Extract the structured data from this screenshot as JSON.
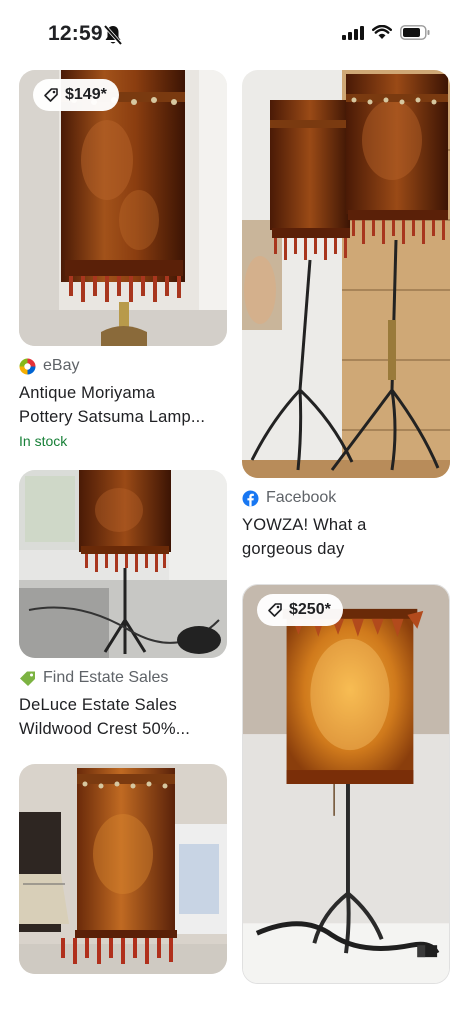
{
  "status_bar": {
    "time": "12:59",
    "icons": [
      "bell-slash-icon",
      "cellular-signal-icon",
      "wifi-icon",
      "battery-icon"
    ]
  },
  "results": {
    "left_column": [
      {
        "price": "$149*",
        "source_icon": "ebay-icon",
        "source": "eBay",
        "title_line1": "Antique Moriyama",
        "title_line2": "Pottery Satsuma Lamp...",
        "availability": "In stock",
        "availability_color": "#188038"
      },
      {
        "source_icon": "tag-icon",
        "source": "Find Estate Sales",
        "title_line1": "DeLuce Estate Sales",
        "title_line2": "Wildwood Crest 50%..."
      },
      {
        "image_only": true
      }
    ],
    "right_column": [
      {
        "source_icon": "facebook-icon",
        "source": "Facebook",
        "title_line1": "YOWZA! What a",
        "title_line2": "gorgeous day"
      },
      {
        "price": "$250*"
      }
    ]
  },
  "colors": {
    "amber": "#9a4a14",
    "amber_glow": "#e8a030",
    "facebook_blue": "#1877f2",
    "estate_tag_green": "#7cb342"
  }
}
